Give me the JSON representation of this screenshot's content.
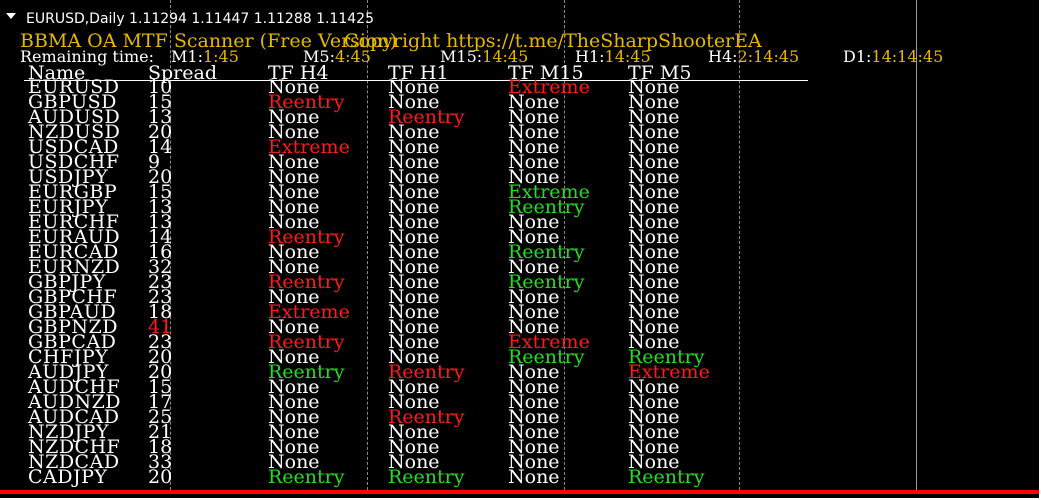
{
  "symbol_info": "EURUSD,Daily  1.11294 1.11447 1.11288 1.11425",
  "title": "BBMA OA MTF Scanner (Free Version)",
  "copyright": "Copyright https://t.me/TheSharpShooterEA",
  "remaining": {
    "label": "Remaining time:",
    "items": [
      {
        "label": "M1:",
        "value": "1:45"
      },
      {
        "label": "M5:",
        "value": "4:45"
      },
      {
        "label": "M15:",
        "value": "14:45"
      },
      {
        "label": "H1:",
        "value": "14:45"
      },
      {
        "label": "H4:",
        "value": "2:14:45"
      },
      {
        "label": "D1:",
        "value": "14:14:45"
      }
    ]
  },
  "columns": [
    "Name",
    "Spread",
    "TF H4",
    "TF H1",
    "TF M15",
    "TF M5"
  ],
  "colors": {
    "red": "#ff1a1a",
    "green": "#22dd22",
    "white": "#ffffff",
    "gold": "#e6b800"
  },
  "rows": [
    {
      "name": "EURUSD",
      "spread": "10",
      "spread_color": "white",
      "h4": "None",
      "h4c": "white",
      "h1": "None",
      "h1c": "white",
      "m15": "Extreme",
      "m15c": "red",
      "m5": "None",
      "m5c": "white"
    },
    {
      "name": "GBPUSD",
      "spread": "15",
      "spread_color": "white",
      "h4": "Reentry",
      "h4c": "red",
      "h1": "None",
      "h1c": "white",
      "m15": "None",
      "m15c": "white",
      "m5": "None",
      "m5c": "white"
    },
    {
      "name": "AUDUSD",
      "spread": "13",
      "spread_color": "white",
      "h4": "None",
      "h4c": "white",
      "h1": "Reentry",
      "h1c": "red",
      "m15": "None",
      "m15c": "white",
      "m5": "None",
      "m5c": "white"
    },
    {
      "name": "NZDUSD",
      "spread": "20",
      "spread_color": "white",
      "h4": "None",
      "h4c": "white",
      "h1": "None",
      "h1c": "white",
      "m15": "None",
      "m15c": "white",
      "m5": "None",
      "m5c": "white"
    },
    {
      "name": "USDCAD",
      "spread": "14",
      "spread_color": "white",
      "h4": "Extreme",
      "h4c": "red",
      "h1": "None",
      "h1c": "white",
      "m15": "None",
      "m15c": "white",
      "m5": "None",
      "m5c": "white"
    },
    {
      "name": "USDCHF",
      "spread": "9",
      "spread_color": "white",
      "h4": "None",
      "h4c": "white",
      "h1": "None",
      "h1c": "white",
      "m15": "None",
      "m15c": "white",
      "m5": "None",
      "m5c": "white"
    },
    {
      "name": "USDJPY",
      "spread": "20",
      "spread_color": "white",
      "h4": "None",
      "h4c": "white",
      "h1": "None",
      "h1c": "white",
      "m15": "None",
      "m15c": "white",
      "m5": "None",
      "m5c": "white"
    },
    {
      "name": "EURGBP",
      "spread": "15",
      "spread_color": "white",
      "h4": "None",
      "h4c": "white",
      "h1": "None",
      "h1c": "white",
      "m15": "Extreme",
      "m15c": "green",
      "m5": "None",
      "m5c": "white"
    },
    {
      "name": "EURJPY",
      "spread": "13",
      "spread_color": "white",
      "h4": "None",
      "h4c": "white",
      "h1": "None",
      "h1c": "white",
      "m15": "Reentry",
      "m15c": "green",
      "m5": "None",
      "m5c": "white"
    },
    {
      "name": "EURCHF",
      "spread": "13",
      "spread_color": "white",
      "h4": "None",
      "h4c": "white",
      "h1": "None",
      "h1c": "white",
      "m15": "None",
      "m15c": "white",
      "m5": "None",
      "m5c": "white"
    },
    {
      "name": "EURAUD",
      "spread": "14",
      "spread_color": "white",
      "h4": "Reentry",
      "h4c": "red",
      "h1": "None",
      "h1c": "white",
      "m15": "None",
      "m15c": "white",
      "m5": "None",
      "m5c": "white"
    },
    {
      "name": "EURCAD",
      "spread": "16",
      "spread_color": "white",
      "h4": "None",
      "h4c": "white",
      "h1": "None",
      "h1c": "white",
      "m15": "Reentry",
      "m15c": "green",
      "m5": "None",
      "m5c": "white"
    },
    {
      "name": "EURNZD",
      "spread": "32",
      "spread_color": "white",
      "h4": "None",
      "h4c": "white",
      "h1": "None",
      "h1c": "white",
      "m15": "None",
      "m15c": "white",
      "m5": "None",
      "m5c": "white"
    },
    {
      "name": "GBPJPY",
      "spread": "23",
      "spread_color": "white",
      "h4": "Reentry",
      "h4c": "red",
      "h1": "None",
      "h1c": "white",
      "m15": "Reentry",
      "m15c": "green",
      "m5": "None",
      "m5c": "white"
    },
    {
      "name": "GBPCHF",
      "spread": "23",
      "spread_color": "white",
      "h4": "None",
      "h4c": "white",
      "h1": "None",
      "h1c": "white",
      "m15": "None",
      "m15c": "white",
      "m5": "None",
      "m5c": "white"
    },
    {
      "name": "GBPAUD",
      "spread": "18",
      "spread_color": "white",
      "h4": "Extreme",
      "h4c": "red",
      "h1": "None",
      "h1c": "white",
      "m15": "None",
      "m15c": "white",
      "m5": "None",
      "m5c": "white"
    },
    {
      "name": "GBPNZD",
      "spread": "41",
      "spread_color": "red",
      "h4": "None",
      "h4c": "white",
      "h1": "None",
      "h1c": "white",
      "m15": "None",
      "m15c": "white",
      "m5": "None",
      "m5c": "white"
    },
    {
      "name": "GBPCAD",
      "spread": "23",
      "spread_color": "white",
      "h4": "Reentry",
      "h4c": "red",
      "h1": "None",
      "h1c": "white",
      "m15": "Extreme",
      "m15c": "red",
      "m5": "None",
      "m5c": "white"
    },
    {
      "name": "CHFJPY",
      "spread": "20",
      "spread_color": "white",
      "h4": "None",
      "h4c": "white",
      "h1": "None",
      "h1c": "white",
      "m15": "Reentry",
      "m15c": "green",
      "m5": "Reentry",
      "m5c": "green"
    },
    {
      "name": "AUDJPY",
      "spread": "20",
      "spread_color": "white",
      "h4": "Reentry",
      "h4c": "green",
      "h1": "Reentry",
      "h1c": "red",
      "m15": "None",
      "m15c": "white",
      "m5": "Extreme",
      "m5c": "red"
    },
    {
      "name": "AUDCHF",
      "spread": "15",
      "spread_color": "white",
      "h4": "None",
      "h4c": "white",
      "h1": "None",
      "h1c": "white",
      "m15": "None",
      "m15c": "white",
      "m5": "None",
      "m5c": "white"
    },
    {
      "name": "AUDNZD",
      "spread": "17",
      "spread_color": "white",
      "h4": "None",
      "h4c": "white",
      "h1": "None",
      "h1c": "white",
      "m15": "None",
      "m15c": "white",
      "m5": "None",
      "m5c": "white"
    },
    {
      "name": "AUDCAD",
      "spread": "25",
      "spread_color": "white",
      "h4": "None",
      "h4c": "white",
      "h1": "Reentry",
      "h1c": "red",
      "m15": "None",
      "m15c": "white",
      "m5": "None",
      "m5c": "white"
    },
    {
      "name": "NZDJPY",
      "spread": "21",
      "spread_color": "white",
      "h4": "None",
      "h4c": "white",
      "h1": "None",
      "h1c": "white",
      "m15": "None",
      "m15c": "white",
      "m5": "None",
      "m5c": "white"
    },
    {
      "name": "NZDCHF",
      "spread": "18",
      "spread_color": "white",
      "h4": "None",
      "h4c": "white",
      "h1": "None",
      "h1c": "white",
      "m15": "None",
      "m15c": "white",
      "m5": "None",
      "m5c": "white"
    },
    {
      "name": "NZDCAD",
      "spread": "33",
      "spread_color": "white",
      "h4": "None",
      "h4c": "white",
      "h1": "None",
      "h1c": "white",
      "m15": "None",
      "m15c": "white",
      "m5": "None",
      "m5c": "white"
    },
    {
      "name": "CADJPY",
      "spread": "20",
      "spread_color": "white",
      "h4": "Reentry",
      "h4c": "green",
      "h1": "Reentry",
      "h1c": "green",
      "m15": "None",
      "m15c": "white",
      "m5": "Reentry",
      "m5c": "green"
    }
  ]
}
